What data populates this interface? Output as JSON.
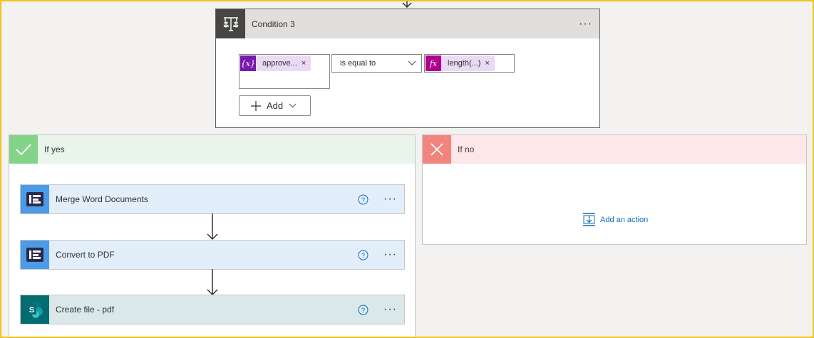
{
  "condition": {
    "title": "Condition 3",
    "more_label": "···",
    "left_token": {
      "label": "approve...",
      "icon": "variable-icon",
      "icon_text": "{x}",
      "remove": "×"
    },
    "operator": "is equal to",
    "right_token": {
      "label": "length(...)",
      "icon": "function-icon",
      "icon_text": "fx",
      "remove": "×"
    },
    "add_label": "Add"
  },
  "branches": {
    "yes": {
      "title": "If yes",
      "actions": [
        {
          "title": "Merge Word Documents",
          "icon": "word-connector-icon",
          "more_label": "···"
        },
        {
          "title": "Convert to PDF",
          "icon": "word-connector-icon",
          "more_label": "···"
        },
        {
          "title": "Create file - pdf",
          "icon": "sharepoint-icon",
          "more_label": "···"
        }
      ]
    },
    "no": {
      "title": "If no",
      "add_action_label": "Add an action"
    }
  },
  "colors": {
    "yes_accent": "#84d38b",
    "no_accent": "#f1857d",
    "token_purple": "#7719aa",
    "token_fx": "#ad008c",
    "link_blue": "#0f6cbd",
    "word_blue": "#4c9be8",
    "sharepoint_teal": "#036c70"
  }
}
